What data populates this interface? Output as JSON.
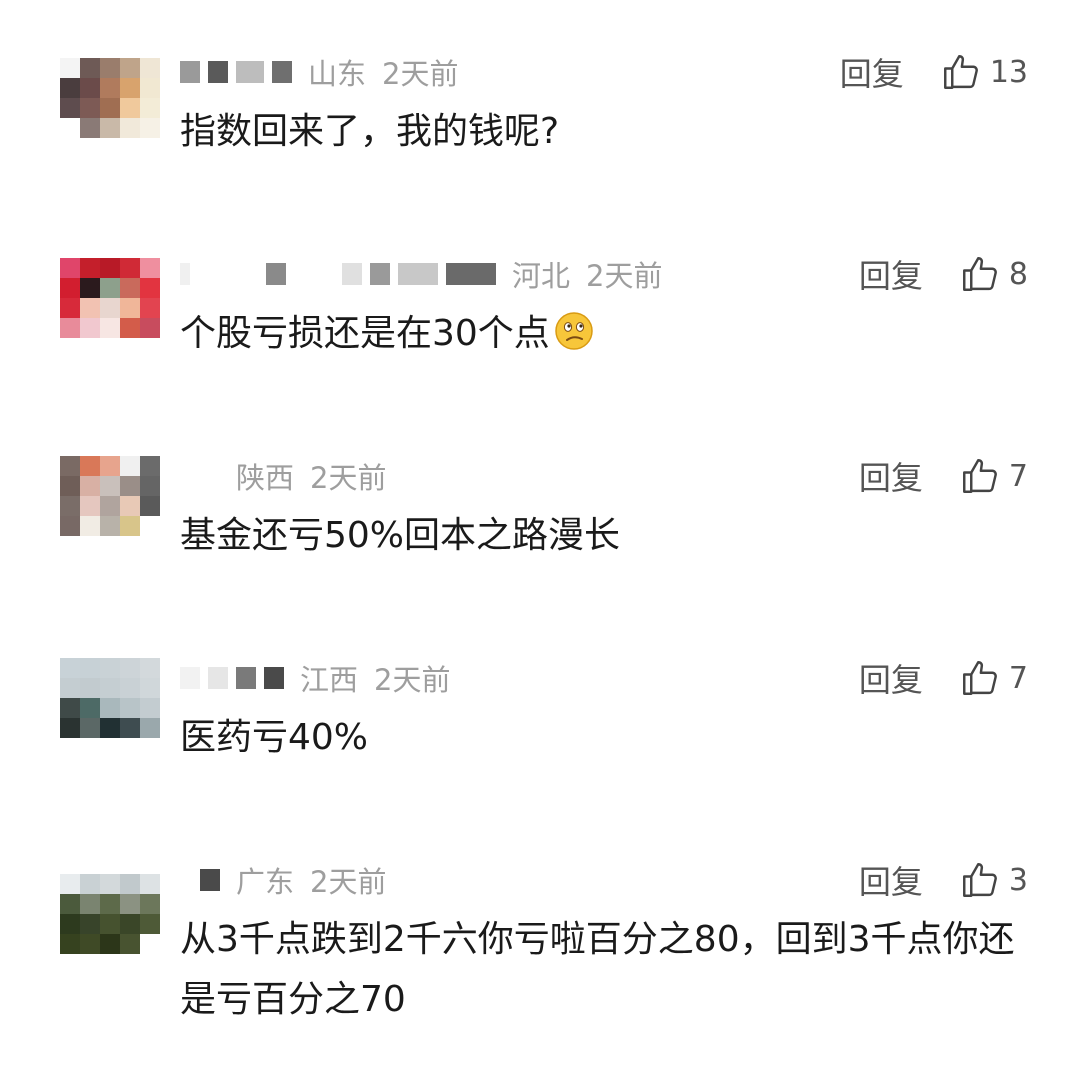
{
  "comments": [
    {
      "location": "山东",
      "time": "2天前",
      "reply_label": "回复",
      "likes": "13",
      "text": "指数回来了，我的钱呢?"
    },
    {
      "location": "河北",
      "time": "2天前",
      "reply_label": "回复",
      "likes": "8",
      "text": "个股亏损还是在30个点",
      "emoji": "confused-face-icon"
    },
    {
      "location": "陕西",
      "time": "2天前",
      "reply_label": "回复",
      "likes": "7",
      "text": "基金还亏50%回本之路漫长"
    },
    {
      "location": "江西",
      "time": "2天前",
      "reply_label": "回复",
      "likes": "7",
      "text": "医药亏40%"
    },
    {
      "location": "广东",
      "time": "2天前",
      "reply_label": "回复",
      "likes": "3",
      "text": "从3千点跌到2千六你亏啦百分之80，回到3千点你还是亏百分之70"
    }
  ],
  "colors": {
    "meta_text": "#9e9e9e",
    "action_text": "#555555",
    "body_text": "#1a1a1a"
  }
}
